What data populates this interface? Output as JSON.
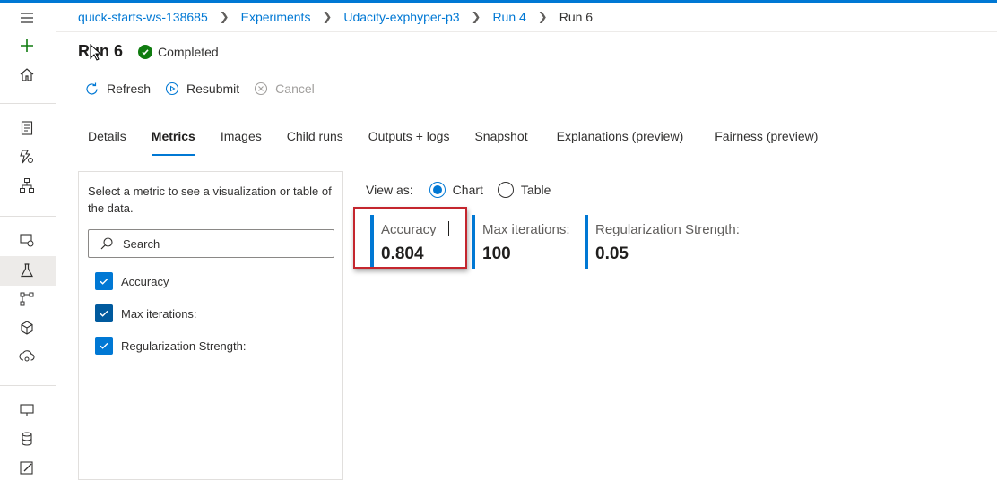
{
  "breadcrumb": [
    {
      "label": "quick-starts-ws-138685"
    },
    {
      "label": "Experiments"
    },
    {
      "label": "Udacity-exphyper-p3"
    },
    {
      "label": "Run 4"
    }
  ],
  "breadcrumb_current": "Run 6",
  "run": {
    "title": "Run 6",
    "status": "Completed"
  },
  "toolbar": {
    "refresh": "Refresh",
    "resubmit": "Resubmit",
    "cancel": "Cancel"
  },
  "tabs": [
    {
      "label": "Details"
    },
    {
      "label": "Metrics"
    },
    {
      "label": "Images"
    },
    {
      "label": "Child runs"
    },
    {
      "label": "Outputs + logs"
    },
    {
      "label": "Snapshot"
    },
    {
      "label": "Explanations (preview)"
    },
    {
      "label": "Fairness (preview)"
    }
  ],
  "active_tab": "Metrics",
  "metrics_panel": {
    "description": "Select a metric to see a visualization or table of the data.",
    "search_placeholder": "Search",
    "items": [
      {
        "label": "Accuracy",
        "checked": true
      },
      {
        "label": "Max iterations:",
        "checked": true
      },
      {
        "label": "Regularization Strength:",
        "checked": true
      }
    ]
  },
  "view_as": {
    "label": "View as:",
    "options": [
      "Chart",
      "Table"
    ],
    "selected": "Chart"
  },
  "metric_cards": [
    {
      "label": "Accuracy",
      "value": "0.804"
    },
    {
      "label": "Max iterations:",
      "value": "100"
    },
    {
      "label": "Regularization Strength:",
      "value": "0.05"
    }
  ],
  "colors": {
    "accent": "#0078d4",
    "success": "#107c10",
    "highlight_border": "#c4262e"
  }
}
